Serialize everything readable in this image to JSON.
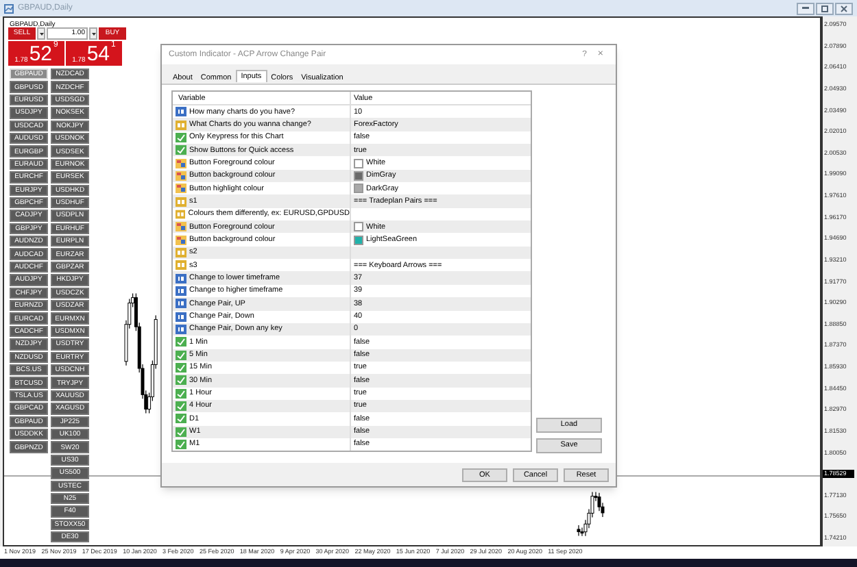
{
  "window": {
    "title": "GBPAUD,Daily"
  },
  "chart": {
    "label": "GBPAUD,Daily",
    "price_axis": [
      {
        "text": "2.09570",
        "current": false
      },
      {
        "text": "2.07890",
        "current": false
      },
      {
        "text": "2.06410",
        "current": false
      },
      {
        "text": "2.04930",
        "current": false
      },
      {
        "text": "2.03490",
        "current": false
      },
      {
        "text": "2.02010",
        "current": false
      },
      {
        "text": "2.00530",
        "current": false
      },
      {
        "text": "1.99090",
        "current": false
      },
      {
        "text": "1.97610",
        "current": false
      },
      {
        "text": "1.96170",
        "current": false
      },
      {
        "text": "1.94690",
        "current": false
      },
      {
        "text": "1.93210",
        "current": false
      },
      {
        "text": "1.91770",
        "current": false
      },
      {
        "text": "1.90290",
        "current": false
      },
      {
        "text": "1.88850",
        "current": false
      },
      {
        "text": "1.87370",
        "current": false
      },
      {
        "text": "1.85930",
        "current": false
      },
      {
        "text": "1.84450",
        "current": false
      },
      {
        "text": "1.82970",
        "current": false
      },
      {
        "text": "1.81530",
        "current": false
      },
      {
        "text": "1.80050",
        "current": false
      },
      {
        "text": "1.78529",
        "current": true
      },
      {
        "text": "1.77130",
        "current": false
      },
      {
        "text": "1.75650",
        "current": false
      },
      {
        "text": "1.74210",
        "current": false
      }
    ],
    "date_axis": [
      "1 Nov 2019",
      "25 Nov 2019",
      "17 Dec 2019",
      "10 Jan 2020",
      "3 Feb 2020",
      "25 Feb 2020",
      "18 Mar 2020",
      "9 Apr 2020",
      "30 Apr 2020",
      "22 May 2020",
      "15 Jun 2020",
      "7 Jul 2020",
      "29 Jul 2020",
      "20 Aug 2020",
      "11 Sep 2020"
    ]
  },
  "trade_panel": {
    "sell": "SELL",
    "buy": "BUY",
    "lot": "1.00",
    "bid": {
      "big": "1.78",
      "pips": "52",
      "fraction": "9"
    },
    "ask": {
      "big": "1.78",
      "pips": "54",
      "fraction": "1"
    }
  },
  "symbol_buttons": {
    "column_1": [
      {
        "label": "GBPAUD",
        "selected": true
      },
      {
        "label": "GBPUSD",
        "selected": false
      },
      {
        "label": "EURUSD",
        "selected": false
      },
      {
        "label": "USDJPY",
        "selected": false
      },
      {
        "label": "USDCAD",
        "selected": false
      },
      {
        "label": "AUDUSD",
        "selected": false
      },
      {
        "label": "EURGBP",
        "selected": false
      },
      {
        "label": "EURAUD",
        "selected": false
      },
      {
        "label": "EURCHF",
        "selected": false
      },
      {
        "label": "EURJPY",
        "selected": false
      },
      {
        "label": "GBPCHF",
        "selected": false
      },
      {
        "label": "CADJPY",
        "selected": false
      },
      {
        "label": "GBPJPY",
        "selected": false
      },
      {
        "label": "AUDNZD",
        "selected": false
      },
      {
        "label": "AUDCAD",
        "selected": false
      },
      {
        "label": "AUDCHF",
        "selected": false
      },
      {
        "label": "AUDJPY",
        "selected": false
      },
      {
        "label": "CHFJPY",
        "selected": false
      },
      {
        "label": "EURNZD",
        "selected": false
      },
      {
        "label": "EURCAD",
        "selected": false
      },
      {
        "label": "CADCHF",
        "selected": false
      },
      {
        "label": "NZDJPY",
        "selected": false
      },
      {
        "label": "NZDUSD",
        "selected": false
      },
      {
        "label": "BCS.US",
        "selected": false
      },
      {
        "label": "BTCUSD",
        "selected": false
      },
      {
        "label": "TSLA.US",
        "selected": false
      },
      {
        "label": "GBPCAD",
        "selected": false
      },
      {
        "label": "GBPAUD",
        "selected": false
      },
      {
        "label": "USDDKK",
        "selected": false
      },
      {
        "label": "GBPNZD",
        "selected": false
      }
    ],
    "column_2": [
      {
        "label": "NZDCAD",
        "selected": false
      },
      {
        "label": "NZDCHF",
        "selected": false
      },
      {
        "label": "USDSGD",
        "selected": false
      },
      {
        "label": "NOKSEK",
        "selected": false
      },
      {
        "label": "NOKJPY",
        "selected": false
      },
      {
        "label": "USDNOK",
        "selected": false
      },
      {
        "label": "USDSEK",
        "selected": false
      },
      {
        "label": "EURNOK",
        "selected": false
      },
      {
        "label": "EURSEK",
        "selected": false
      },
      {
        "label": "USDHKD",
        "selected": false
      },
      {
        "label": "USDHUF",
        "selected": false
      },
      {
        "label": "USDPLN",
        "selected": false
      },
      {
        "label": "EURHUF",
        "selected": false
      },
      {
        "label": "EURPLN",
        "selected": false
      },
      {
        "label": "EURZAR",
        "selected": false
      },
      {
        "label": "GBPZAR",
        "selected": false
      },
      {
        "label": "HKDJPY",
        "selected": false
      },
      {
        "label": "USDCZK",
        "selected": false
      },
      {
        "label": "USDZAR",
        "selected": false
      },
      {
        "label": "EURMXN",
        "selected": false
      },
      {
        "label": "USDMXN",
        "selected": false
      },
      {
        "label": "USDTRY",
        "selected": false
      },
      {
        "label": "EURTRY",
        "selected": false
      },
      {
        "label": "USDCNH",
        "selected": false
      },
      {
        "label": "TRYJPY",
        "selected": false
      },
      {
        "label": "XAUUSD",
        "selected": false
      },
      {
        "label": "XAGUSD",
        "selected": false
      },
      {
        "label": "JP225",
        "selected": false
      },
      {
        "label": "UK100",
        "selected": false
      },
      {
        "label": "SW20",
        "selected": false
      },
      {
        "label": "US30",
        "selected": false
      },
      {
        "label": "US500",
        "selected": false
      },
      {
        "label": "USTEC",
        "selected": false
      },
      {
        "label": "N25",
        "selected": false
      },
      {
        "label": "F40",
        "selected": false
      },
      {
        "label": "STOXX50",
        "selected": false
      },
      {
        "label": "DE30",
        "selected": false
      }
    ]
  },
  "dialog": {
    "title": "Custom Indicator - ACP Arrow Change Pair",
    "help": "?",
    "close": "×",
    "tabs": [
      {
        "label": "About",
        "selected": false
      },
      {
        "label": "Common",
        "selected": false
      },
      {
        "label": "Inputs",
        "selected": true
      },
      {
        "label": "Colors",
        "selected": false
      },
      {
        "label": "Visualization",
        "selected": false
      }
    ],
    "table": {
      "columns": [
        "Variable",
        "Value"
      ],
      "rows": [
        {
          "kind": "int",
          "variable": "How many charts do you have?",
          "value": "10"
        },
        {
          "kind": "string",
          "variable": "What Charts do you wanna change?",
          "value": "ForexFactory"
        },
        {
          "kind": "bool",
          "variable": "Only Keypress for this Chart",
          "value": "false"
        },
        {
          "kind": "bool",
          "variable": "Show Buttons for Quick access",
          "value": "true"
        },
        {
          "kind": "color",
          "variable": "Button Foreground colour",
          "value": "White",
          "color": "#ffffff"
        },
        {
          "kind": "color",
          "variable": "Button background colour",
          "value": "DimGray",
          "color": "#696969"
        },
        {
          "kind": "color",
          "variable": "Button highlight colour",
          "value": "DarkGray",
          "color": "#a9a9a9"
        },
        {
          "kind": "string",
          "variable": "s1",
          "value": "=== Tradeplan Pairs ==="
        },
        {
          "kind": "string",
          "variable": "Colours them differently, ex: EURUSD,GPDUSD"
        },
        {
          "kind": "color",
          "variable": "Button Foreground colour",
          "value": "White",
          "color": "#ffffff"
        },
        {
          "kind": "color",
          "variable": "Button background colour",
          "value": "LightSeaGreen",
          "color": "#20b2aa"
        },
        {
          "kind": "string",
          "variable": "s2"
        },
        {
          "kind": "string",
          "variable": "s3",
          "value": "=== Keyboard Arrows ==="
        },
        {
          "kind": "int",
          "variable": "Change to lower timeframe",
          "value": "37"
        },
        {
          "kind": "int",
          "variable": "Change to higher timeframe",
          "value": "39"
        },
        {
          "kind": "int",
          "variable": "Change Pair, UP",
          "value": "38"
        },
        {
          "kind": "int",
          "variable": "Change Pair, Down",
          "value": "40"
        },
        {
          "kind": "int",
          "variable": "Change Pair, Down any key",
          "value": "0"
        },
        {
          "kind": "bool",
          "variable": "1 Min",
          "value": "false"
        },
        {
          "kind": "bool",
          "variable": "5 Min",
          "value": "false"
        },
        {
          "kind": "bool",
          "variable": "15 Min",
          "value": "true"
        },
        {
          "kind": "bool",
          "variable": "30 Min",
          "value": "false"
        },
        {
          "kind": "bool",
          "variable": "1 Hour",
          "value": "true"
        },
        {
          "kind": "bool",
          "variable": "4 Hour",
          "value": "true"
        },
        {
          "kind": "bool",
          "variable": "D1",
          "value": "false"
        },
        {
          "kind": "bool",
          "variable": "W1",
          "value": "false"
        },
        {
          "kind": "bool",
          "variable": "M1",
          "value": "false"
        }
      ]
    },
    "side_buttons": [
      "Load",
      "Save"
    ],
    "buttons": [
      "OK",
      "Cancel",
      "Reset"
    ]
  }
}
